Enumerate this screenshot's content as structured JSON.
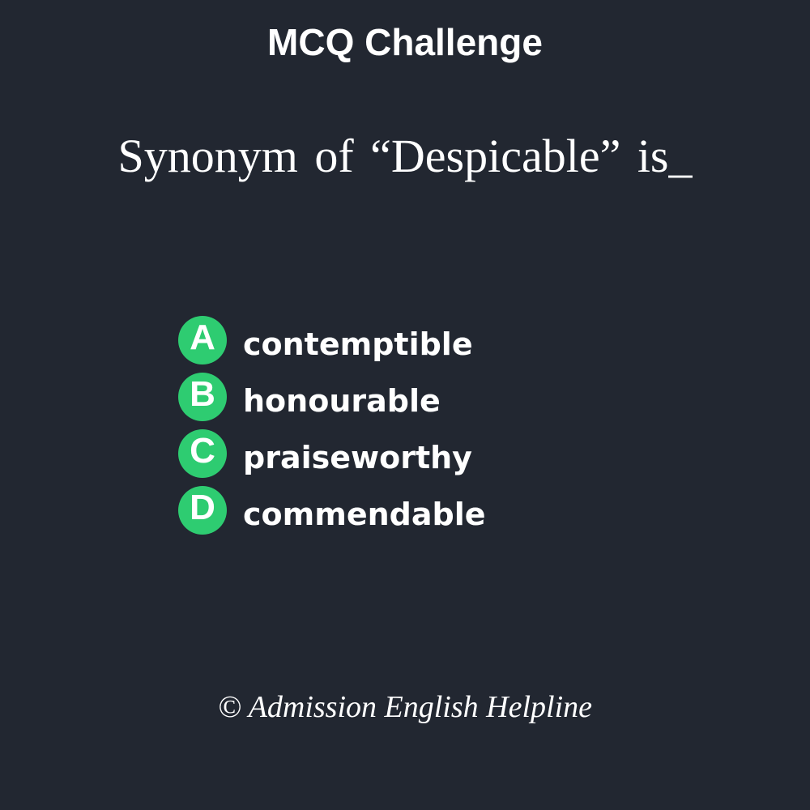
{
  "header": {
    "title": "MCQ Challenge"
  },
  "question": {
    "text": "Synonym of “Despicable” is_"
  },
  "options": [
    {
      "letter": "A",
      "text": "contemptible"
    },
    {
      "letter": "B",
      "text": "honourable"
    },
    {
      "letter": "C",
      "text": "praiseworthy"
    },
    {
      "letter": "D",
      "text": "commendable"
    }
  ],
  "footer": {
    "credit": "© Admission English Helpline"
  },
  "colors": {
    "background": "#222731",
    "badge": "#2ecc71",
    "text": "#ffffff"
  }
}
